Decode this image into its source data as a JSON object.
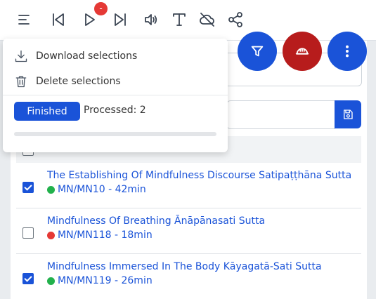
{
  "toolbar": {
    "icons": [
      "menu-icon",
      "skip-back-icon",
      "play-icon",
      "skip-forward-icon",
      "audio-icon",
      "text-icon",
      "cloud-off-icon",
      "share-icon"
    ],
    "badge": "-"
  },
  "menu": {
    "download_label": "Download selections",
    "delete_label": "Delete selections",
    "status_label": "Finished",
    "processed_label": "Processed: 2",
    "progress": 0
  },
  "colors": {
    "accent": "#1a53d8",
    "danger": "#b71c1c",
    "green": "#22b14c",
    "red": "#e53935"
  },
  "rows": [
    {
      "title": "The Establishing Of Mindfulness Discourse Satipaṭṭhāna Sutta",
      "meta": "MN/MN10 - 42min",
      "status": "green",
      "checked": true
    },
    {
      "title": "Mindfulness Of Breathing Ānāpānasati Sutta",
      "meta": "MN/MN118 - 18min",
      "status": "red",
      "checked": false
    },
    {
      "title": "Mindfulness Immersed In The Body Kāyagatā-Sati Sutta",
      "meta": "MN/MN119 - 26min",
      "status": "green",
      "checked": true
    }
  ]
}
